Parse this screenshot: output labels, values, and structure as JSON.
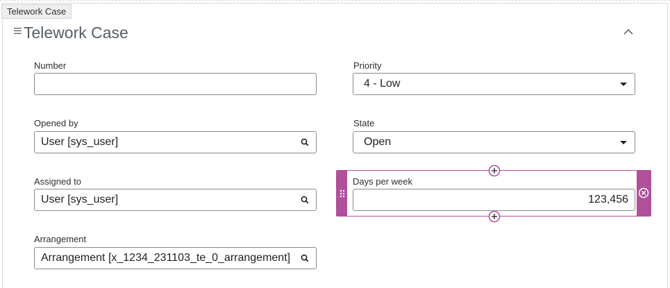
{
  "tab": {
    "label": "Telework Case"
  },
  "section": {
    "title": "Telework Case"
  },
  "fields": {
    "number": {
      "label": "Number",
      "value": ""
    },
    "priority": {
      "label": "Priority",
      "value": "4 - Low"
    },
    "opened_by": {
      "label": "Opened by",
      "value": "User [sys_user]"
    },
    "state": {
      "label": "State",
      "value": "Open"
    },
    "assigned_to": {
      "label": "Assigned to",
      "value": "User [sys_user]"
    },
    "days_per_week": {
      "label": "Days per week",
      "value": "123,456"
    },
    "arrangement": {
      "label": "Arrangement",
      "value": "Arrangement [x_1234_231103_te_0_arrangement]"
    }
  },
  "icons": {
    "menu": "menu-icon",
    "collapse": "chevron-up-icon",
    "reference_lookup": "search-icon",
    "choice_dropdown": "caret-down-icon",
    "drag": "drag-handle-icon",
    "remove": "remove-circle-icon",
    "add": "add-circle-icon"
  },
  "colors": {
    "selection_accent": "#b0509b",
    "title": "#545d66",
    "input_border": "#8a8a8a"
  }
}
